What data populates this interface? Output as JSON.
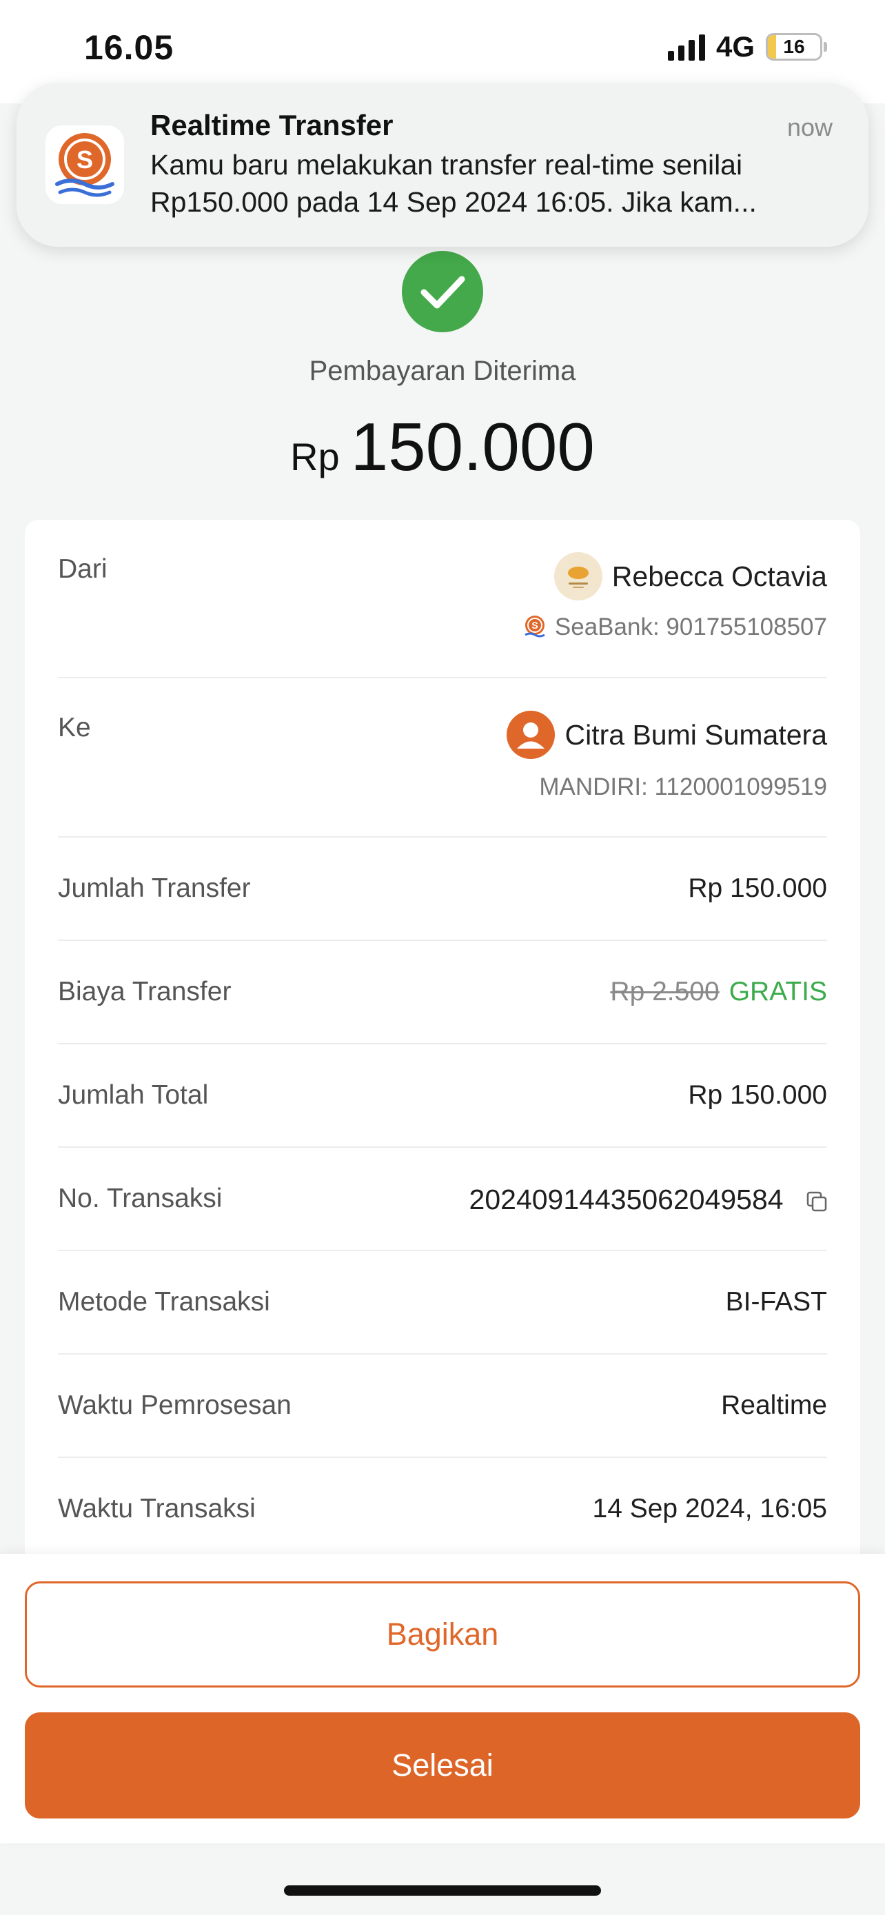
{
  "status_bar": {
    "time": "16.05",
    "network": "4G",
    "battery_level": "16",
    "battery_fraction": 0.16
  },
  "notification": {
    "app_icon": "seabank-logo-icon",
    "title": "Realtime Transfer",
    "time": "now",
    "body_line1": "Kamu baru melakukan transfer real-time senilai",
    "body_line2": "Rp150.000 pada 14 Sep 2024 16:05. Jika kam..."
  },
  "header": {
    "status_icon": "check-circle-icon",
    "status_text": "Pembayaran Diterima",
    "currency": "Rp",
    "amount": "150.000"
  },
  "details": {
    "from": {
      "label": "Dari",
      "name": "Rebecca Octavia",
      "account": "SeaBank: 901755108507"
    },
    "to": {
      "label": "Ke",
      "name": "Citra Bumi Sumatera",
      "account": "MANDIRI: 1120001099519"
    },
    "transfer_amount": {
      "label": "Jumlah Transfer",
      "value": "Rp 150.000"
    },
    "transfer_fee": {
      "label": "Biaya Transfer",
      "original": "Rp 2.500",
      "value": "GRATIS"
    },
    "total_amount": {
      "label": "Jumlah Total",
      "value": "Rp 150.000"
    },
    "transaction_no": {
      "label": "No. Transaksi",
      "value": "20240914435062049584"
    },
    "method": {
      "label": "Metode Transaksi",
      "value": "BI-FAST"
    },
    "processing_time": {
      "label": "Waktu Pemrosesan",
      "value": "Realtime"
    },
    "transaction_time": {
      "label": "Waktu Transaksi",
      "value": "14 Sep 2024, 16:05"
    }
  },
  "actions": {
    "share_label": "Bagikan",
    "done_label": "Selesai"
  },
  "colors": {
    "accent": "#de6528",
    "success": "#43a94a",
    "free_text": "#3cab4c"
  }
}
